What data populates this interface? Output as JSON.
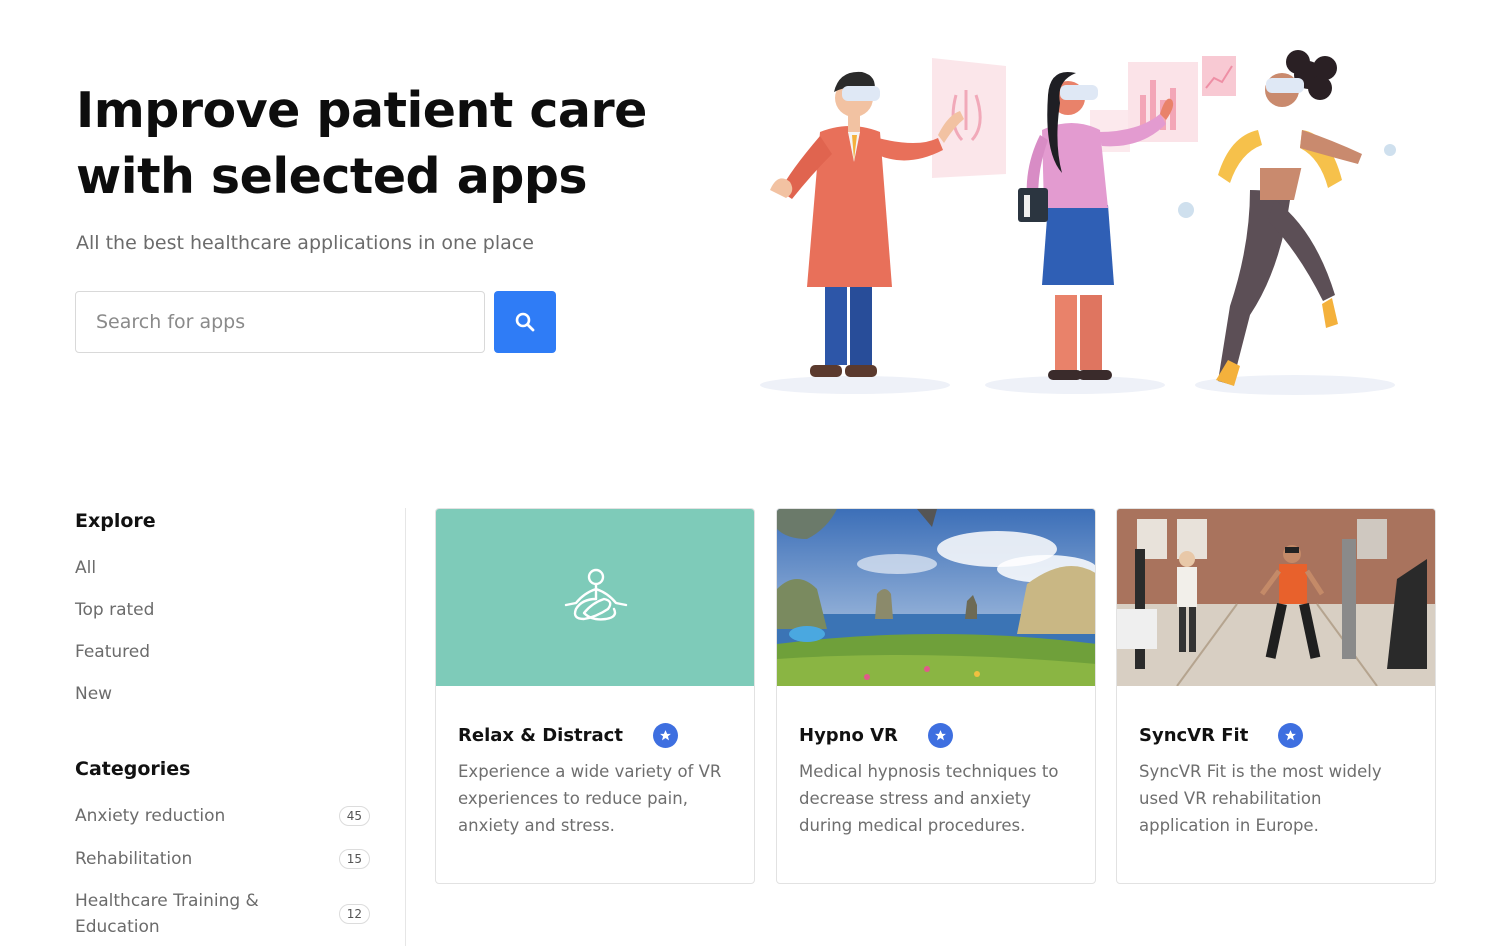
{
  "hero": {
    "title": "Improve patient care with selected apps",
    "subtitle": "All the best healthcare applications in one place",
    "search_placeholder": "Search for apps"
  },
  "sidebar": {
    "explore_heading": "Explore",
    "explore_items": [
      "All",
      "Top rated",
      "Featured",
      "New"
    ],
    "categories_heading": "Categories",
    "categories": [
      {
        "label": "Anxiety reduction",
        "count": "45"
      },
      {
        "label": "Rehabilitation",
        "count": "15"
      },
      {
        "label": "Healthcare Training & Education",
        "count": "12"
      }
    ]
  },
  "apps": [
    {
      "title": "Relax & Distract",
      "description": "Experience a wide variety of VR experiences to reduce pain, anxiety and stress.",
      "icon": "meditation-icon",
      "media_color": "#7ecbb9"
    },
    {
      "title": "Hypno VR",
      "description": "Medical hypnosis techniques to decrease stress and anxiety during medical procedures.",
      "icon": "landscape-image"
    },
    {
      "title": "SyncVR Fit",
      "description": "SyncVR Fit is the most widely used VR rehabilitation application in Europe.",
      "icon": "gym-photo"
    }
  ],
  "colors": {
    "accent": "#2f7cf6",
    "badge": "#3e6fe0",
    "teal": "#7ecbb9"
  }
}
